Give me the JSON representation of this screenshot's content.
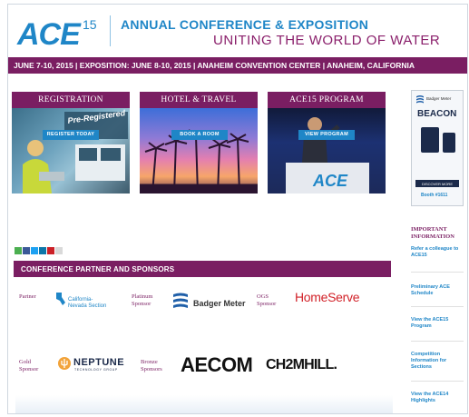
{
  "header": {
    "logo": "ACE",
    "logo_sup": "15",
    "title_line1": "ANNUAL CONFERENCE & EXPOSITION",
    "title_line2": "UNITING THE WORLD OF WATER",
    "date_bar": "JUNE 7-10, 2015 | EXPOSITION: JUNE 8-10, 2015 | ANAHEIM CONVENTION CENTER | ANAHEIM, CALIFORNIA"
  },
  "cards": [
    {
      "title": "REGISTRATION",
      "button": "REGISTER TODAY",
      "image_text": "Pre-Registered"
    },
    {
      "title": "HOTEL & TRAVEL",
      "button": "BOOK A ROOM"
    },
    {
      "title": "ACE15 PROGRAM",
      "button": "VIEW PROGRAM",
      "image_text": "ACE"
    }
  ],
  "sponsors": {
    "heading": "CONFERENCE PARTNER AND SPONSORS",
    "partner_label": "Partner",
    "partner_name": "California-Nevada Section",
    "platinum_label": "Platinum Sponsor",
    "platinum_name": "Badger Meter",
    "ogs_label": "OGS Sponsor",
    "ogs_name": "HomeServe",
    "gold_label": "Gold Sponsor",
    "gold_name": "NEPTUNE",
    "gold_sub": "TECHNOLOGY GROUP",
    "bronze_label": "Bronze Sponsors",
    "bronze_1": "AECOM",
    "bronze_2": "CH2MHILL."
  },
  "sidebar": {
    "ad_brand": "Badger Meter",
    "ad_product": "BEACON",
    "ad_button": "DISCOVER MORE",
    "ad_booth": "Booth #1611",
    "important_label": "IMPORTANT INFORMATION",
    "links": [
      "Refer a colleague to ACE15",
      "Preliminary ACE Schedule",
      "View the ACE15 Program",
      "Competition Information for Sections",
      "View the ACE14 Highlights"
    ]
  },
  "colors": {
    "brand_blue": "#1f86c7",
    "brand_purple": "#7a1e62"
  }
}
